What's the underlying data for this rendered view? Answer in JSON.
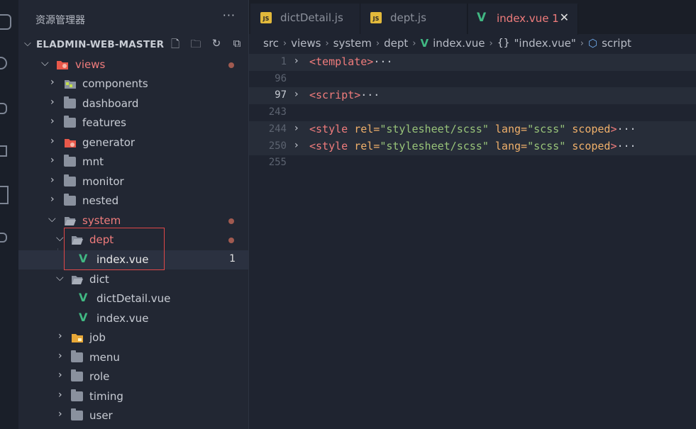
{
  "explorer": {
    "title": "资源管理器",
    "more": "···",
    "project": "ELADMIN-WEB-MASTER",
    "tree": [
      {
        "label": "views",
        "color": "#f07c7c"
      },
      {
        "label": "components"
      },
      {
        "label": "dashboard"
      },
      {
        "label": "features"
      },
      {
        "label": "generator"
      },
      {
        "label": "mnt"
      },
      {
        "label": "monitor"
      },
      {
        "label": "nested"
      },
      {
        "label": "system",
        "color": "#f07c7c"
      },
      {
        "label": "dept",
        "color": "#f07c7c"
      },
      {
        "label": "index.vue",
        "badge": "1"
      },
      {
        "label": "dict"
      },
      {
        "label": "dictDetail.vue"
      },
      {
        "label": "index.vue"
      },
      {
        "label": "job"
      },
      {
        "label": "menu"
      },
      {
        "label": "role"
      },
      {
        "label": "timing"
      },
      {
        "label": "user"
      }
    ]
  },
  "tabs": [
    {
      "label": "dictDetail.js",
      "icon": "JS"
    },
    {
      "label": "dept.js",
      "icon": "JS"
    },
    {
      "label": "index.vue 1",
      "close": "✕"
    }
  ],
  "breadcrumb": {
    "items": [
      "src",
      "views",
      "system",
      "dept",
      "index.vue",
      "\"index.vue\"",
      "script"
    ],
    "braces": "{}"
  },
  "editor": {
    "lines": [
      {
        "num": "1",
        "text": "<template>"
      },
      {
        "num": "96"
      },
      {
        "num": "97",
        "text": "<script>"
      },
      {
        "num": "243"
      },
      {
        "num": "244",
        "text": "<style rel=\"stylesheet/scss\" lang=\"scss\" scoped>"
      },
      {
        "num": "250",
        "text": "<style rel=\"stylesheet/scss\" lang=\"scss\" scoped>"
      },
      {
        "num": "255"
      }
    ],
    "ellipsis": "···"
  },
  "colors": {
    "accent": "#f07c7c",
    "vue": "#41b883",
    "highlight": "#e04848"
  }
}
